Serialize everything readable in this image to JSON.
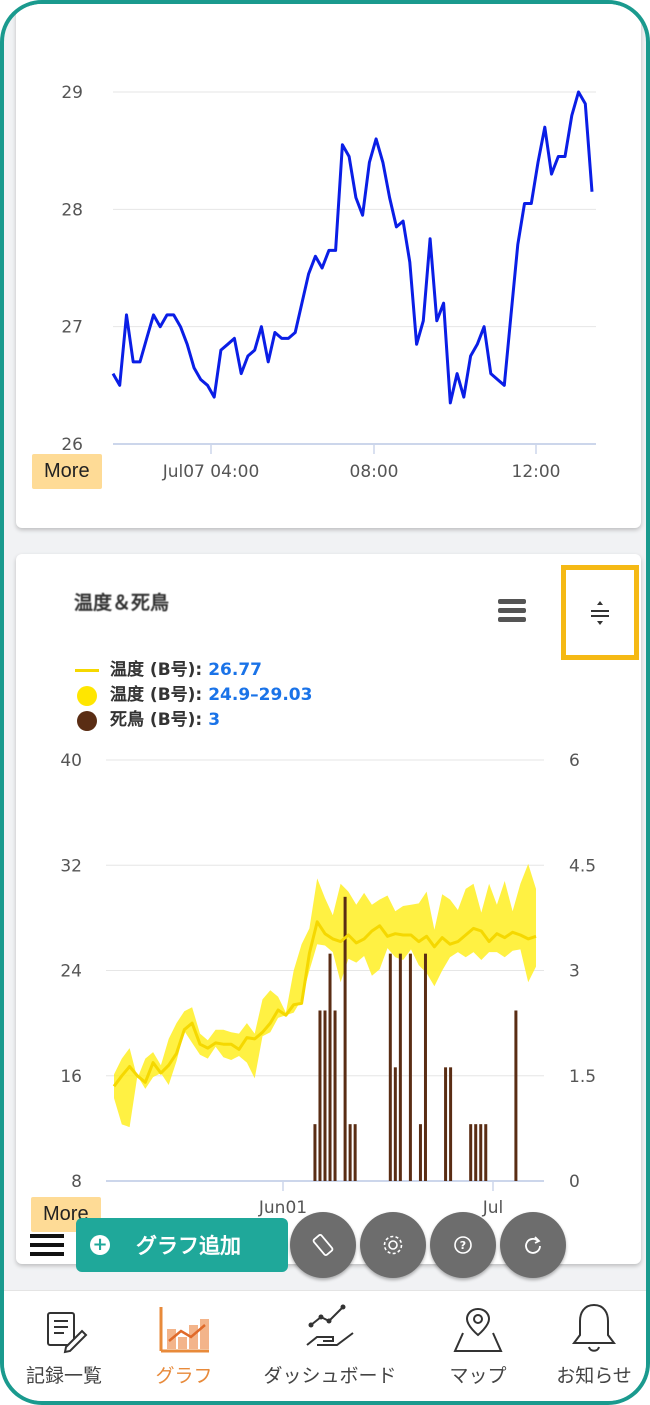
{
  "chart1": {
    "type": "line",
    "y_ticks": [
      "29",
      "28",
      "27",
      "26"
    ],
    "x_ticks": [
      "Jul07 04:00",
      "08:00",
      "12:00"
    ],
    "ylim": [
      26,
      29.3
    ],
    "series": [
      {
        "color": "#0a1ee6",
        "values": [
          26.6,
          26.5,
          27.1,
          26.7,
          26.7,
          26.9,
          27.1,
          27.0,
          27.1,
          27.1,
          27.0,
          26.85,
          26.65,
          26.55,
          26.5,
          26.4,
          26.8,
          26.85,
          26.9,
          26.6,
          26.75,
          26.8,
          27.0,
          26.7,
          26.95,
          26.9,
          26.9,
          26.95,
          27.2,
          27.45,
          27.6,
          27.5,
          27.65,
          27.65,
          28.55,
          28.45,
          28.1,
          27.95,
          28.4,
          28.6,
          28.4,
          28.1,
          27.85,
          27.9,
          27.55,
          26.85,
          27.05,
          27.75,
          27.05,
          27.2,
          26.35,
          26.6,
          26.4,
          26.75,
          26.85,
          27.0,
          26.6,
          26.55,
          26.5,
          27.1,
          27.7,
          28.05,
          28.05,
          28.4,
          28.7,
          28.3,
          28.45,
          28.45,
          28.8,
          29.0,
          28.9,
          28.15
        ]
      }
    ],
    "more_label": "More"
  },
  "chart2": {
    "title": "温度＆死鳥",
    "legend": [
      {
        "label": "温度 (B号):",
        "value": "26.77",
        "kind": "line",
        "color": "#f5d800"
      },
      {
        "label": "温度 (B号):",
        "value": "24.9–29.03",
        "kind": "dot",
        "color": "#ffe600"
      },
      {
        "label": "死鳥 (B号):",
        "value": "3",
        "kind": "dot",
        "color": "#5a2d14"
      }
    ],
    "more_label": "More"
  },
  "chart_data": {
    "type": "line",
    "x_ticks": [
      "Jun01",
      "Jul"
    ],
    "y_left_ticks": [
      "40",
      "32",
      "24",
      "16",
      "8"
    ],
    "y_right_ticks": [
      "6",
      "4.5",
      "3",
      "1.5",
      "0"
    ],
    "y_left_lim": [
      8,
      40
    ],
    "y_right_lim": [
      0,
      6
    ],
    "series": [
      {
        "name": "温度 (B号)",
        "type": "line",
        "color": "#f5d800",
        "values": [
          15.2,
          16.0,
          16.7,
          16.0,
          15.5,
          17.0,
          16.2,
          16.8,
          17.7,
          19.5,
          20.0,
          18.4,
          18.1,
          18.5,
          18.4,
          18.4,
          18.0,
          18.9,
          18.8,
          19.3,
          20.0,
          21.0,
          20.6,
          21.4,
          21.5,
          25.3,
          27.7,
          26.8,
          26.4,
          26.2,
          26.7,
          26.1,
          26.4,
          27.0,
          27.4,
          26.6,
          26.8,
          26.7,
          26.7,
          26.2,
          26.6,
          25.8,
          26.5,
          26.0,
          26.2,
          26.7,
          27.2,
          27.0,
          26.2,
          26.8,
          26.5,
          26.9,
          26.7,
          26.4,
          26.6
        ]
      },
      {
        "name": "温度 (B号)",
        "type": "arearange",
        "color": "#ffe600",
        "low": [
          14.3,
          12.3,
          12.1,
          16.0,
          15.0,
          15.9,
          16.2,
          15.3,
          17.1,
          19.4,
          18.5,
          17.6,
          17.3,
          18.2,
          17.4,
          17.2,
          17.5,
          17.0,
          15.8,
          19.0,
          19.3,
          20.4,
          20.6,
          20.8,
          21.8,
          24.0,
          26.0,
          25.9,
          25.4,
          23.1,
          24.9,
          24.6,
          25.1,
          23.6,
          24.1,
          25.7,
          25.0,
          24.8,
          25.6,
          24.4,
          23.8,
          22.8,
          24.0,
          25.0,
          25.4,
          25.0,
          25.4,
          24.8,
          25.4,
          25.4,
          25.0,
          25.5,
          25.6,
          23.1,
          24.3
        ],
        "high": [
          16.1,
          17.3,
          18.1,
          15.8,
          17.3,
          17.8,
          16.8,
          18.8,
          20.0,
          20.9,
          21.2,
          19.2,
          18.7,
          19.5,
          19.5,
          19.3,
          19.2,
          20.0,
          19.2,
          21.8,
          22.5,
          22.0,
          20.8,
          24.0,
          26.0,
          27.2,
          31.0,
          29.5,
          28.2,
          30.6,
          30.0,
          29.0,
          29.9,
          29.0,
          29.4,
          29.7,
          28.5,
          28.9,
          29.0,
          29.1,
          30.0,
          27.1,
          29.8,
          29.4,
          28.6,
          30.2,
          30.6,
          28.4,
          30.6,
          29.0,
          30.8,
          28.5,
          30.6,
          32.1,
          30.2
        ]
      },
      {
        "name": "死鳥 (B号)",
        "type": "column",
        "axis": "right",
        "color": "#5a2d14",
        "x_index": [
          40,
          41,
          42,
          43,
          44,
          46,
          47,
          48,
          55,
          56,
          57,
          59,
          61,
          62,
          66,
          67,
          71,
          72,
          73,
          74,
          80
        ],
        "values": [
          1,
          3,
          3,
          4,
          3,
          5,
          1,
          1,
          4,
          2,
          4,
          4,
          1,
          4,
          2,
          2,
          1,
          1,
          1,
          1,
          3
        ]
      }
    ]
  },
  "toolbar": {
    "add_graph_label": "グラフ追加"
  },
  "nav": {
    "items": [
      {
        "label": "記録一覧"
      },
      {
        "label": "グラフ"
      },
      {
        "label": "ダッシュボード"
      },
      {
        "label": "マップ"
      },
      {
        "label": "お知らせ"
      }
    ]
  }
}
